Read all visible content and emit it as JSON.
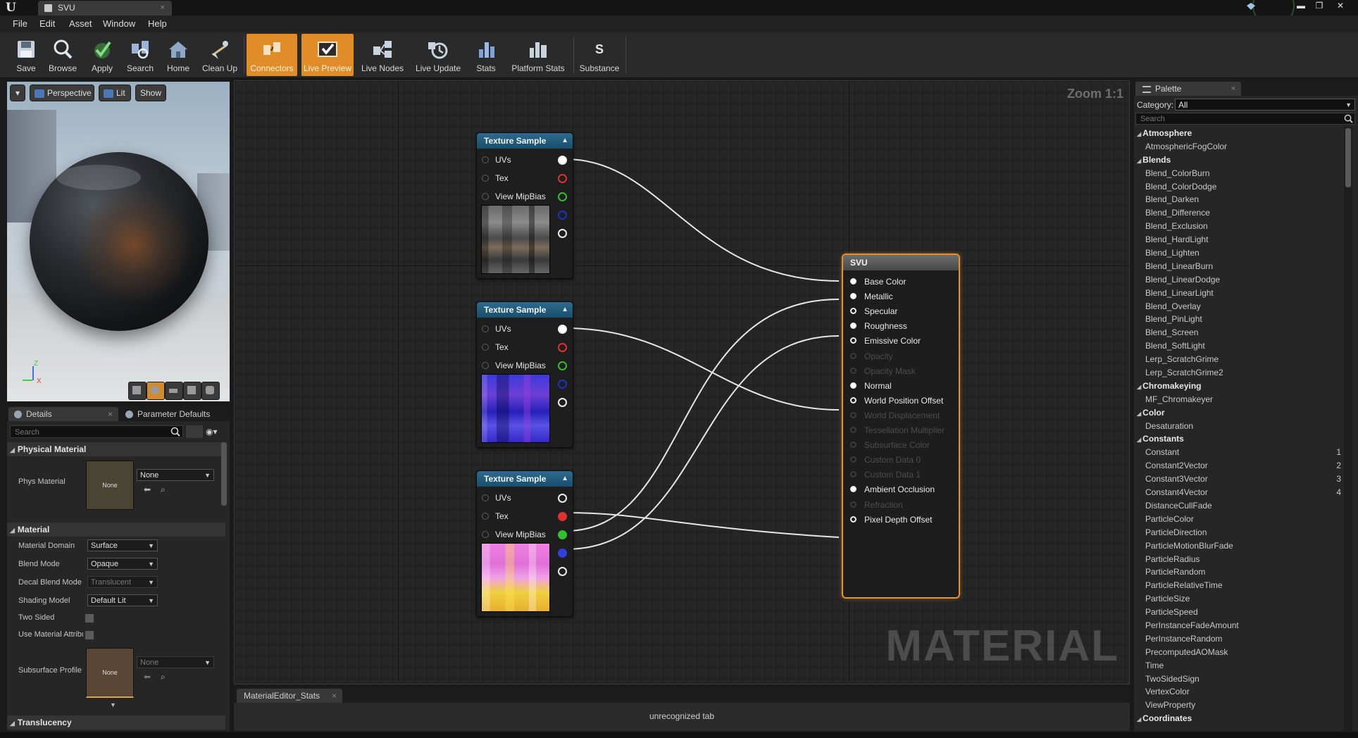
{
  "window": {
    "tab_title": "SVU",
    "tab_close": "×",
    "controls": [
      "▬",
      "❐",
      "✕"
    ]
  },
  "menu": [
    "File",
    "Edit",
    "Asset",
    "Window",
    "Help"
  ],
  "toolbar": {
    "buttons": [
      {
        "label": "Save",
        "icon": "save-icon",
        "active": false
      },
      {
        "label": "Browse",
        "icon": "browse-icon",
        "active": false
      },
      {
        "label": "Apply",
        "icon": "apply-icon",
        "active": false
      },
      {
        "label": "Search",
        "icon": "search-icon",
        "active": false
      },
      {
        "label": "Home",
        "icon": "home-icon",
        "active": false
      },
      {
        "label": "Clean Up",
        "icon": "clean-up-icon",
        "active": false
      },
      {
        "label": "Connectors",
        "icon": "connectors-icon",
        "active": true
      },
      {
        "label": "Live Preview",
        "icon": "live-preview-icon",
        "active": true
      },
      {
        "label": "Live Nodes",
        "icon": "live-nodes-icon",
        "active": false
      },
      {
        "label": "Live Update",
        "icon": "live-update-icon",
        "active": false
      },
      {
        "label": "Stats",
        "icon": "stats-icon",
        "active": false
      },
      {
        "label": "Platform Stats",
        "icon": "platform-stats-icon",
        "active": false
      },
      {
        "label": "Substance",
        "icon": "substance-icon",
        "active": false
      }
    ],
    "accent": "#e08c28"
  },
  "viewport": {
    "perspective_label": "Perspective",
    "lit_label": "Lit",
    "show_label": "Show",
    "axis_z": "Z",
    "axis_x": "X"
  },
  "details": {
    "tab_details": "Details",
    "tab_params": "Parameter Defaults",
    "search_placeholder": "Search",
    "physical_material": {
      "header": "Physical Material",
      "phys_material_label": "Phys Material",
      "thumb_text": "None",
      "value": "None"
    },
    "material": {
      "header": "Material",
      "rows": [
        {
          "label": "Material Domain",
          "value": "Surface",
          "disabled": false
        },
        {
          "label": "Blend Mode",
          "value": "Opaque",
          "disabled": false
        },
        {
          "label": "Decal Blend Mode",
          "value": "Translucent",
          "disabled": true
        },
        {
          "label": "Shading Model",
          "value": "Default Lit",
          "disabled": false
        }
      ],
      "two_sided_label": "Two Sided",
      "use_attr_label": "Use Material Attributes",
      "subsurface_label": "Subsurface Profile",
      "subsurface_thumb": "None",
      "subsurface_value": "None"
    },
    "translucency_header": "Translucency"
  },
  "graph": {
    "zoom": "Zoom 1:1",
    "watermark": "MATERIAL",
    "texture_nodes": [
      {
        "title": "Texture Sample",
        "pins": [
          "UVs",
          "Tex",
          "View MipBias"
        ],
        "thumb": "dark"
      },
      {
        "title": "Texture Sample",
        "pins": [
          "UVs",
          "Tex",
          "View MipBias"
        ],
        "thumb": "normal"
      },
      {
        "title": "Texture Sample",
        "pins": [
          "UVs",
          "Tex",
          "View MipBias"
        ],
        "thumb": "pink"
      }
    ],
    "output_colors": [
      "#ffffff",
      "#e03030",
      "#30c030",
      "#3040e0",
      "#ffffff"
    ],
    "svu_node": {
      "title": "SVU",
      "pins": [
        {
          "label": "Base Color",
          "enabled": true,
          "connected": true
        },
        {
          "label": "Metallic",
          "enabled": true,
          "connected": true
        },
        {
          "label": "Specular",
          "enabled": true,
          "connected": false
        },
        {
          "label": "Roughness",
          "enabled": true,
          "connected": true
        },
        {
          "label": "Emissive Color",
          "enabled": true,
          "connected": false
        },
        {
          "label": "Opacity",
          "enabled": false,
          "connected": false
        },
        {
          "label": "Opacity Mask",
          "enabled": false,
          "connected": false
        },
        {
          "label": "Normal",
          "enabled": true,
          "connected": true
        },
        {
          "label": "World Position Offset",
          "enabled": true,
          "connected": false
        },
        {
          "label": "World Displacement",
          "enabled": false,
          "connected": false
        },
        {
          "label": "Tessellation Multiplier",
          "enabled": false,
          "connected": false
        },
        {
          "label": "Subsurface Color",
          "enabled": false,
          "connected": false
        },
        {
          "label": "Custom Data 0",
          "enabled": false,
          "connected": false
        },
        {
          "label": "Custom Data 1",
          "enabled": false,
          "connected": false
        },
        {
          "label": "Ambient Occlusion",
          "enabled": true,
          "connected": true
        },
        {
          "label": "Refraction",
          "enabled": false,
          "connected": false
        },
        {
          "label": "Pixel Depth Offset",
          "enabled": true,
          "connected": false
        }
      ],
      "accent": "#e8912b"
    }
  },
  "stats": {
    "tab_label": "MaterialEditor_Stats",
    "tab_close": "×",
    "message": "unrecognized tab"
  },
  "palette": {
    "tab_label": "Palette",
    "tab_close": "×",
    "category_label": "Category:",
    "category_value": "All",
    "search_placeholder": "Search",
    "entries": [
      {
        "type": "cat",
        "label": "Atmosphere"
      },
      {
        "type": "item",
        "label": "AtmosphericFogColor"
      },
      {
        "type": "cat",
        "label": "Blends"
      },
      {
        "type": "item",
        "label": "Blend_ColorBurn"
      },
      {
        "type": "item",
        "label": "Blend_ColorDodge"
      },
      {
        "type": "item",
        "label": "Blend_Darken"
      },
      {
        "type": "item",
        "label": "Blend_Difference"
      },
      {
        "type": "item",
        "label": "Blend_Exclusion"
      },
      {
        "type": "item",
        "label": "Blend_HardLight"
      },
      {
        "type": "item",
        "label": "Blend_Lighten"
      },
      {
        "type": "item",
        "label": "Blend_LinearBurn"
      },
      {
        "type": "item",
        "label": "Blend_LinearDodge"
      },
      {
        "type": "item",
        "label": "Blend_LinearLight"
      },
      {
        "type": "item",
        "label": "Blend_Overlay"
      },
      {
        "type": "item",
        "label": "Blend_PinLight"
      },
      {
        "type": "item",
        "label": "Blend_Screen"
      },
      {
        "type": "item",
        "label": "Blend_SoftLight"
      },
      {
        "type": "item",
        "label": "Lerp_ScratchGrime"
      },
      {
        "type": "item",
        "label": "Lerp_ScratchGrime2"
      },
      {
        "type": "cat",
        "label": "Chromakeying"
      },
      {
        "type": "item",
        "label": "MF_Chromakeyer"
      },
      {
        "type": "cat",
        "label": "Color"
      },
      {
        "type": "item",
        "label": "Desaturation"
      },
      {
        "type": "cat",
        "label": "Constants"
      },
      {
        "type": "item",
        "label": "Constant",
        "shortcut": "1"
      },
      {
        "type": "item",
        "label": "Constant2Vector",
        "shortcut": "2"
      },
      {
        "type": "item",
        "label": "Constant3Vector",
        "shortcut": "3"
      },
      {
        "type": "item",
        "label": "Constant4Vector",
        "shortcut": "4"
      },
      {
        "type": "item",
        "label": "DistanceCullFade"
      },
      {
        "type": "item",
        "label": "ParticleColor"
      },
      {
        "type": "item",
        "label": "ParticleDirection"
      },
      {
        "type": "item",
        "label": "ParticleMotionBlurFade"
      },
      {
        "type": "item",
        "label": "ParticleRadius"
      },
      {
        "type": "item",
        "label": "ParticleRandom"
      },
      {
        "type": "item",
        "label": "ParticleRelativeTime"
      },
      {
        "type": "item",
        "label": "ParticleSize"
      },
      {
        "type": "item",
        "label": "ParticleSpeed"
      },
      {
        "type": "item",
        "label": "PerInstanceFadeAmount"
      },
      {
        "type": "item",
        "label": "PerInstanceRandom"
      },
      {
        "type": "item",
        "label": "PrecomputedAOMask"
      },
      {
        "type": "item",
        "label": "Time"
      },
      {
        "type": "item",
        "label": "TwoSidedSign"
      },
      {
        "type": "item",
        "label": "VertexColor"
      },
      {
        "type": "item",
        "label": "ViewProperty"
      },
      {
        "type": "cat",
        "label": "Coordinates"
      }
    ]
  }
}
